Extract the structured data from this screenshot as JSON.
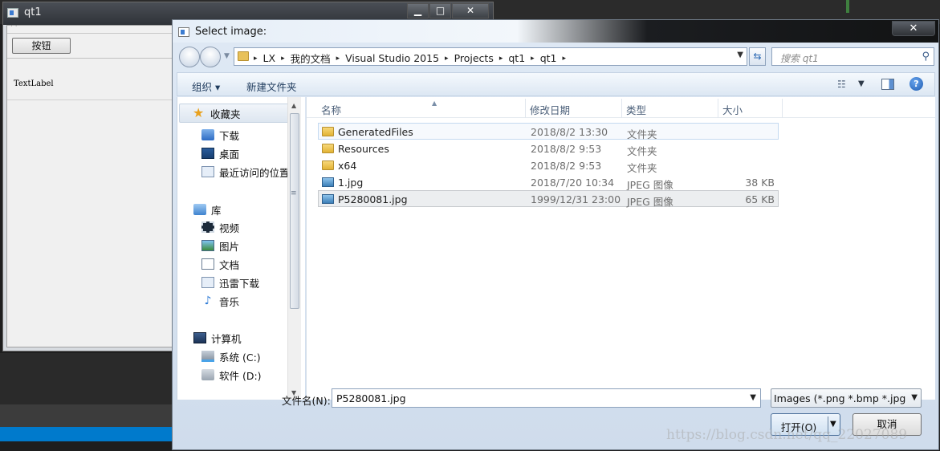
{
  "qt1_window": {
    "title": "qt1",
    "button_label": "按钮",
    "label_text": "TextLabel",
    "menu_hint": "· ·"
  },
  "dialog": {
    "title": "Select image:",
    "close_glyph": "✕",
    "breadcrumbs": [
      "LX",
      "我的文档",
      "Visual Studio 2015",
      "Projects",
      "qt1",
      "qt1"
    ],
    "search_placeholder": "搜索 qt1",
    "toolbar": {
      "organize": "组织 ▾",
      "new_folder": "新建文件夹"
    },
    "nav_pane": {
      "favorites": "收藏夹",
      "fav_items": [
        "下载",
        "桌面",
        "最近访问的位置"
      ],
      "libraries": "库",
      "lib_items": [
        "视频",
        "图片",
        "文档",
        "迅雷下载",
        "音乐"
      ],
      "computer": "计算机",
      "drives": [
        "系统 (C:)",
        "软件 (D:)"
      ]
    },
    "columns": [
      "名称",
      "修改日期",
      "类型",
      "大小"
    ],
    "files": [
      {
        "name": "GeneratedFiles",
        "date": "2018/8/2 13:30",
        "type": "文件夹",
        "size": "",
        "kind": "folder"
      },
      {
        "name": "Resources",
        "date": "2018/8/2 9:53",
        "type": "文件夹",
        "size": "",
        "kind": "folder"
      },
      {
        "name": "x64",
        "date": "2018/8/2 9:53",
        "type": "文件夹",
        "size": "",
        "kind": "folder"
      },
      {
        "name": "1.jpg",
        "date": "2018/7/20 10:34",
        "type": "JPEG 图像",
        "size": "38 KB",
        "kind": "image"
      },
      {
        "name": "P5280081.jpg",
        "date": "1999/12/31 23:00",
        "type": "JPEG 图像",
        "size": "65 KB",
        "kind": "image"
      }
    ],
    "filename_label": "文件名(N):",
    "filename_value": "P5280081.jpg",
    "filter_value": "Images (*.png *.bmp *.jpg *.",
    "open_label": "打开(O)",
    "cancel_label": "取消"
  },
  "watermark": "https://blog.csdn.net/qq_22027089"
}
